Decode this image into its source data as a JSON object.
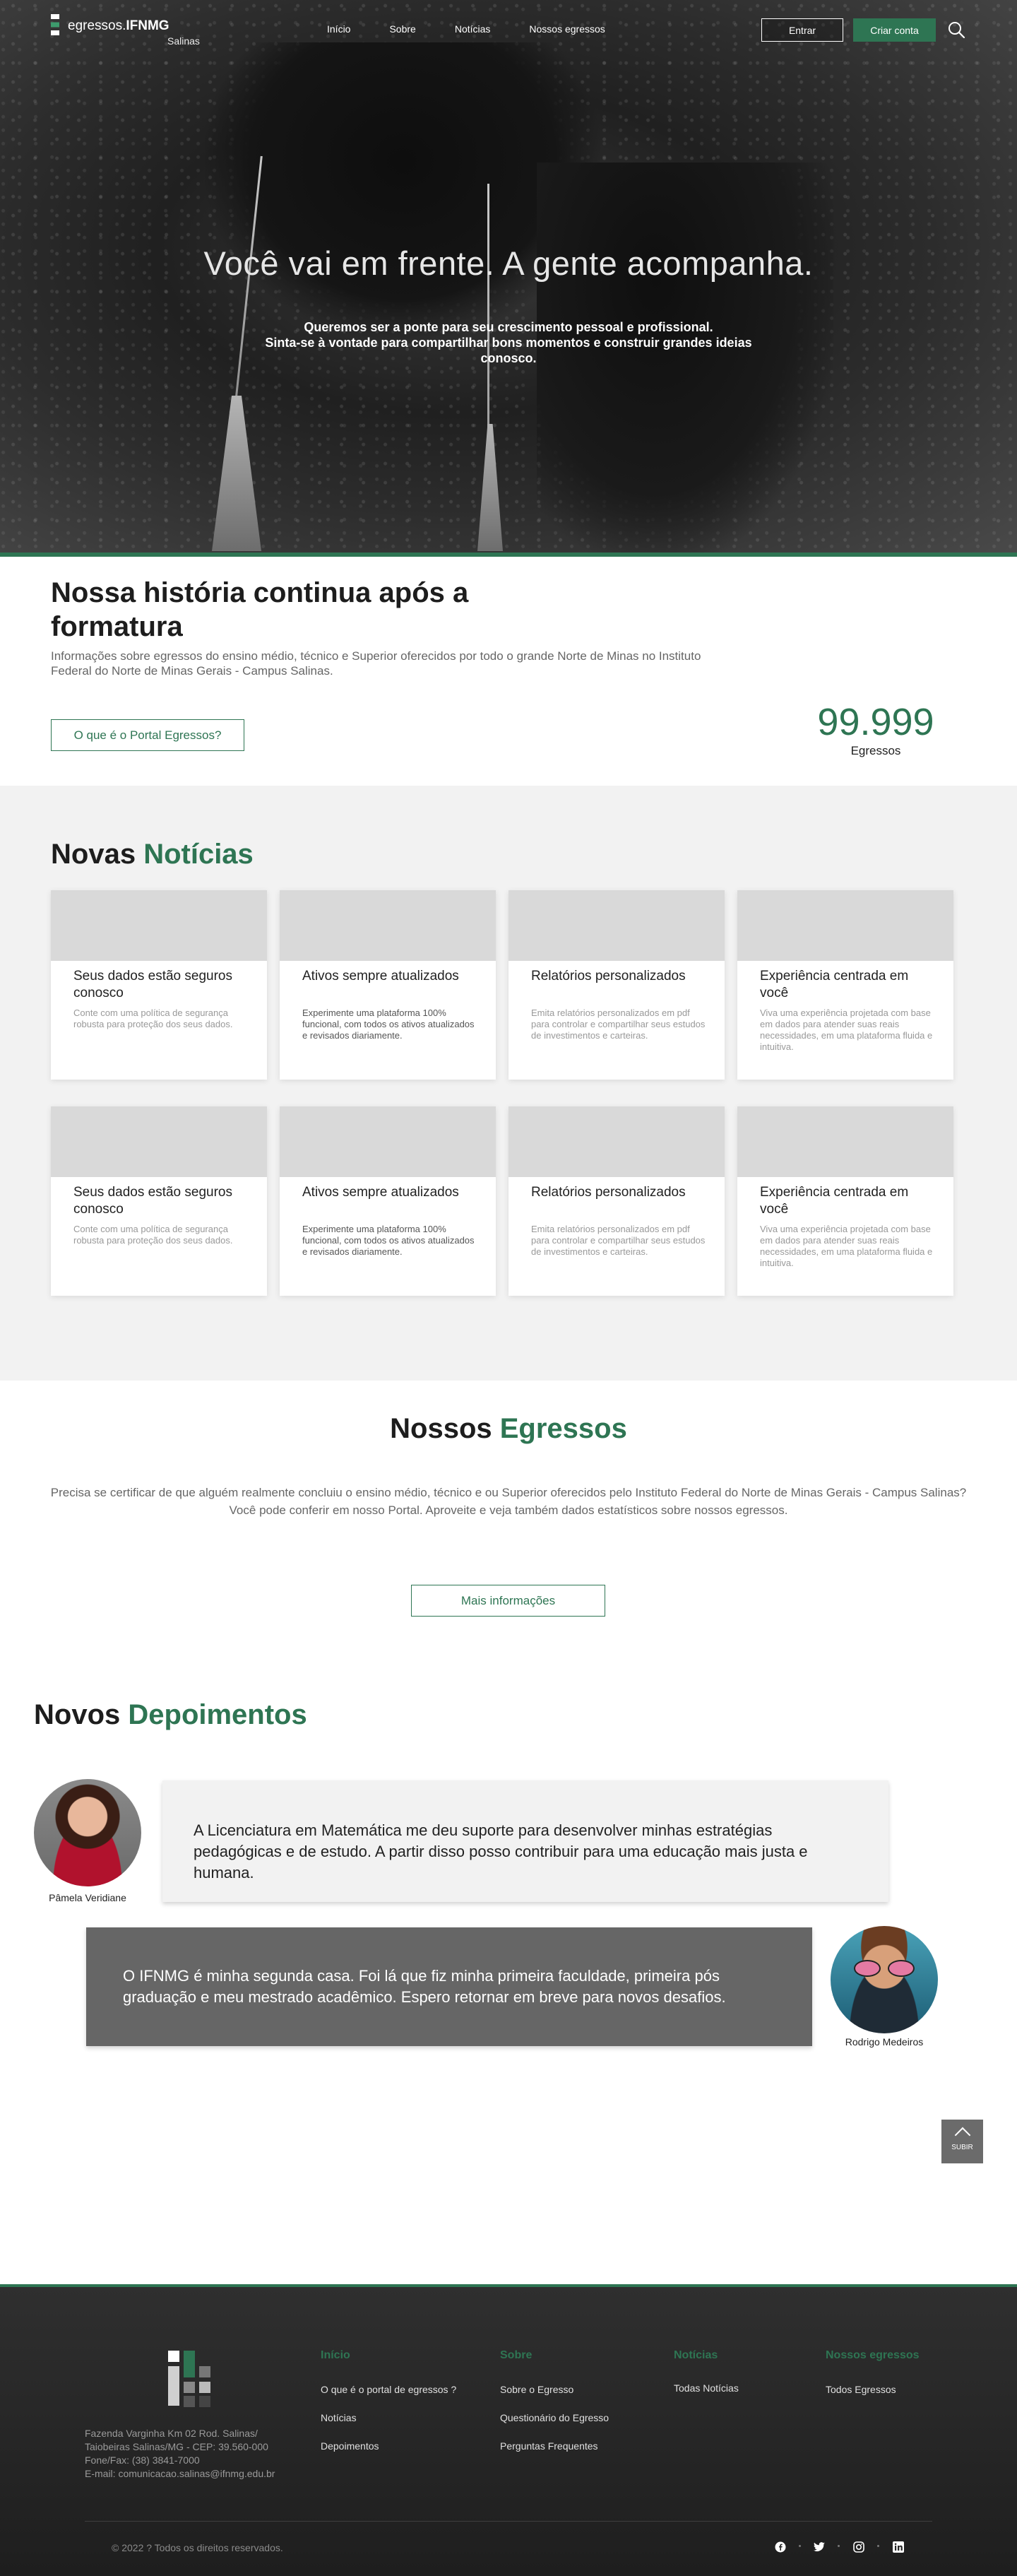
{
  "nav": {
    "logo_text_regular": "egressos.",
    "logo_text_bold": "IFNMG",
    "logo_sub": "Salinas",
    "links": [
      "Início",
      "Sobre",
      "Notícias",
      "Nossos egressos"
    ],
    "login": "Entrar",
    "signup": "Criar conta",
    "search_icon": "search-icon"
  },
  "hero": {
    "title": "Você vai em frente. A gente acompanha.",
    "subtitle_line1": "Queremos ser a ponte para seu crescimento pessoal e profissional.",
    "subtitle_line2": "Sinta-se à vontade para compartilhar bons momentos e construir grandes ideias conosco."
  },
  "history": {
    "title": "Nossa história continua após a formatura",
    "text": "Informações sobre egressos do ensino médio, técnico e Superior oferecidos por todo o grande Norte de Minas no Instituto Federal do Norte de Minas Gerais - Campus Salinas.",
    "button": "O que é o Portal Egressos?",
    "counter_value": "99.999",
    "counter_label": "Egressos"
  },
  "news": {
    "title_a": "Novas",
    "title_b": "Notícias",
    "cards": [
      {
        "title": "Seus dados estão seguros conosco",
        "text": "Conte com uma política de segurança robusta para proteção dos seus dados."
      },
      {
        "title": "Ativos sempre atualizados",
        "text": "Experimente uma plataforma 100% funcional, com todos os ativos atualizados e revisados diariamente."
      },
      {
        "title": "Relatórios personalizados",
        "text": "Emita relatórios personalizados em pdf para controlar e compartilhar seus estudos de investimentos e carteiras."
      },
      {
        "title": "Experiência centrada em você",
        "text": "Viva uma experiência projetada com base em dados para atender suas reais necessidades, em uma plataforma fluida e intuitiva."
      },
      {
        "title": "Seus dados estão seguros conosco",
        "text": "Conte com uma política de segurança robusta para proteção dos seus dados."
      },
      {
        "title": "Ativos sempre atualizados",
        "text": "Experimente uma plataforma 100% funcional, com todos os ativos atualizados e revisados diariamente."
      },
      {
        "title": "Relatórios personalizados",
        "text": "Emita relatórios personalizados em pdf para controlar e compartilhar seus estudos de investimentos e carteiras."
      },
      {
        "title": "Experiência centrada em você",
        "text": "Viva uma experiência projetada com base em dados para atender suas reais necessidades, em uma plataforma fluida e intuitiva."
      }
    ]
  },
  "egressos": {
    "title_a": "Nossos",
    "title_b": "Egressos",
    "text_line1": "Precisa se certificar de que alguém realmente concluiu o ensino médio, técnico e ou Superior oferecidos pelo Instituto Federal do Norte de Minas Gerais - Campus Salinas?",
    "text_line2": "Você pode conferir em nosso Portal. Aproveite e veja também dados estatísticos sobre nossos egressos.",
    "button": "Mais informações"
  },
  "testimonials": {
    "title_a": "Novos",
    "title_b": "Depoimentos",
    "items": [
      {
        "name": "Pâmela Veridiane",
        "text": "A Licenciatura em Matemática me deu suporte para desenvolver minhas estratégias pedagógicas e de estudo. A partir disso posso contribuir para uma educação mais justa e humana."
      },
      {
        "name": "Rodrigo Medeiros",
        "text": "O IFNMG é minha segunda casa. Foi lá que fiz minha primeira faculdade, primeira pós graduação e meu mestrado acadêmico. Espero retornar em breve para novos desafios."
      }
    ]
  },
  "back_to_top": "SUBIR",
  "footer": {
    "address_line1": "Fazenda Varginha Km 02 Rod. Salinas/",
    "address_line2": "Taiobeiras Salinas/MG - CEP: 39.560-000",
    "address_line3": "Fone/Fax: (38) 3841-7000",
    "address_line4": "E-mail: comunicacao.salinas@ifnmg.edu.br",
    "columns": [
      {
        "title": "Início",
        "links": [
          "O que é o portal de egressos ?",
          "Notícias",
          "Depoimentos"
        ]
      },
      {
        "title": "Sobre",
        "links": [
          "Sobre o Egresso",
          "Questionário do Egresso",
          "Perguntas Frequentes"
        ]
      },
      {
        "title": "Notícias",
        "links": [
          "Todas Notícias"
        ]
      },
      {
        "title": "Nossos egressos",
        "links": [
          "Todos Egressos"
        ]
      }
    ],
    "copyright": "© 2022 ? Todos os direitos reservados.",
    "social_icons": [
      "facebook-icon",
      "twitter-icon",
      "instagram-icon",
      "linkedin-icon"
    ]
  },
  "colors": {
    "brand_green": "#2e7553",
    "footer_bg": "#262626",
    "card_placeholder": "#d9d9d9"
  }
}
